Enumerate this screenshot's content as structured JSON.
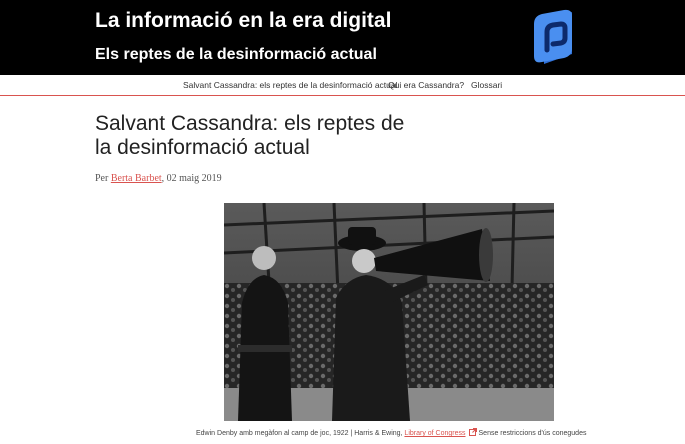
{
  "header": {
    "site_title": "La informació en la era digital",
    "site_subtitle": "Els reptes de la desinformació actual",
    "logo_icon": "megaphone-logo-icon"
  },
  "nav": {
    "items": [
      {
        "label": "Salvant Cassandra: els reptes de la desinformació actual"
      },
      {
        "label": "Qui era Cassandra?"
      },
      {
        "label": "Glossari"
      }
    ]
  },
  "article": {
    "title": "Salvant Cassandra: els reptes de la desinformació actual",
    "byline_prefix": "Per ",
    "author": "Berta Barbet",
    "date": ", 02 maig 2019"
  },
  "image": {
    "caption_text": "Edwin Denby amb megàfon al camp de joc, 1922 | Harris & Ewing, ",
    "caption_link": "Library of Congress",
    "caption_license": "Sense restriccions d'ús conegudes",
    "license_icon": "external-link-icon"
  },
  "colors": {
    "header_bg": "#000000",
    "accent": "#d9534f",
    "logo_blue": "#4a8ff0"
  }
}
